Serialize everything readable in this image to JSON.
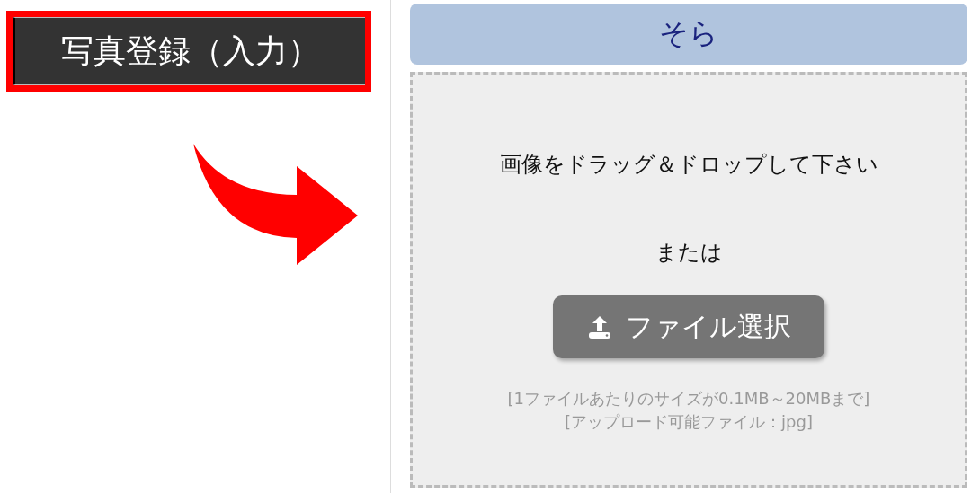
{
  "photo_register_button": {
    "label": "写真登録（入力）",
    "highlighted": true
  },
  "upload": {
    "header": "そら",
    "drop_hint": "画像をドラッグ＆ドロップして下さい",
    "or_text": "または",
    "file_button": "ファイル選択",
    "notes": [
      "[1ファイルあたりのサイズが0.1MB～20MBまで]",
      "[アップロード可能ファイル：jpg]"
    ]
  }
}
